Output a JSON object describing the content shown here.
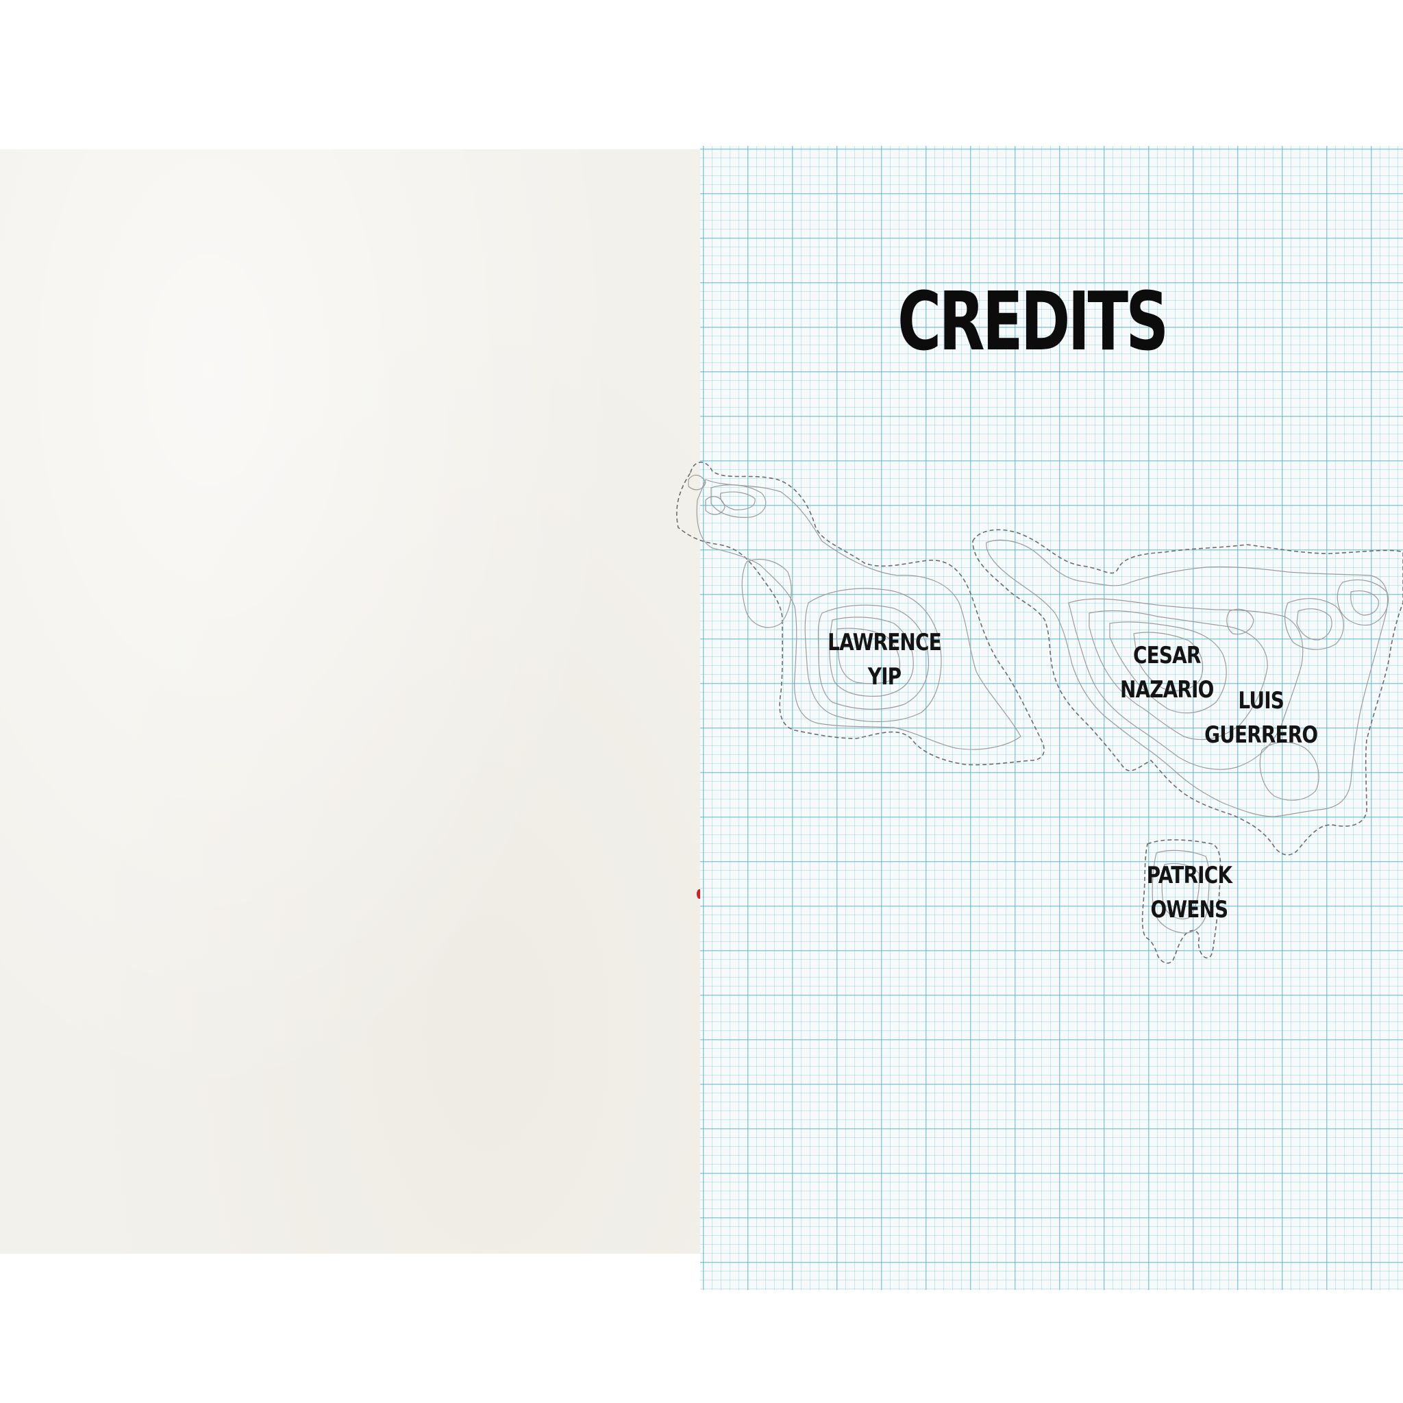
{
  "page_title": "CREDITS",
  "credits": [
    {
      "first": "LAWRENCE",
      "last": "YIP"
    },
    {
      "first": "CESAR",
      "last": "NAZARIO"
    },
    {
      "first": "LUIS",
      "last": "GUERRERO"
    },
    {
      "first": "PATRICK",
      "last": "OWENS"
    }
  ],
  "colors": {
    "left_paper": "#f3f1ec",
    "grid_paper": "#f7fafb",
    "grid_lines": "#56b2cd",
    "contour_lines": "#9c9c9c",
    "text": "#0c0c0c",
    "accent_mark": "#d61f1f"
  }
}
